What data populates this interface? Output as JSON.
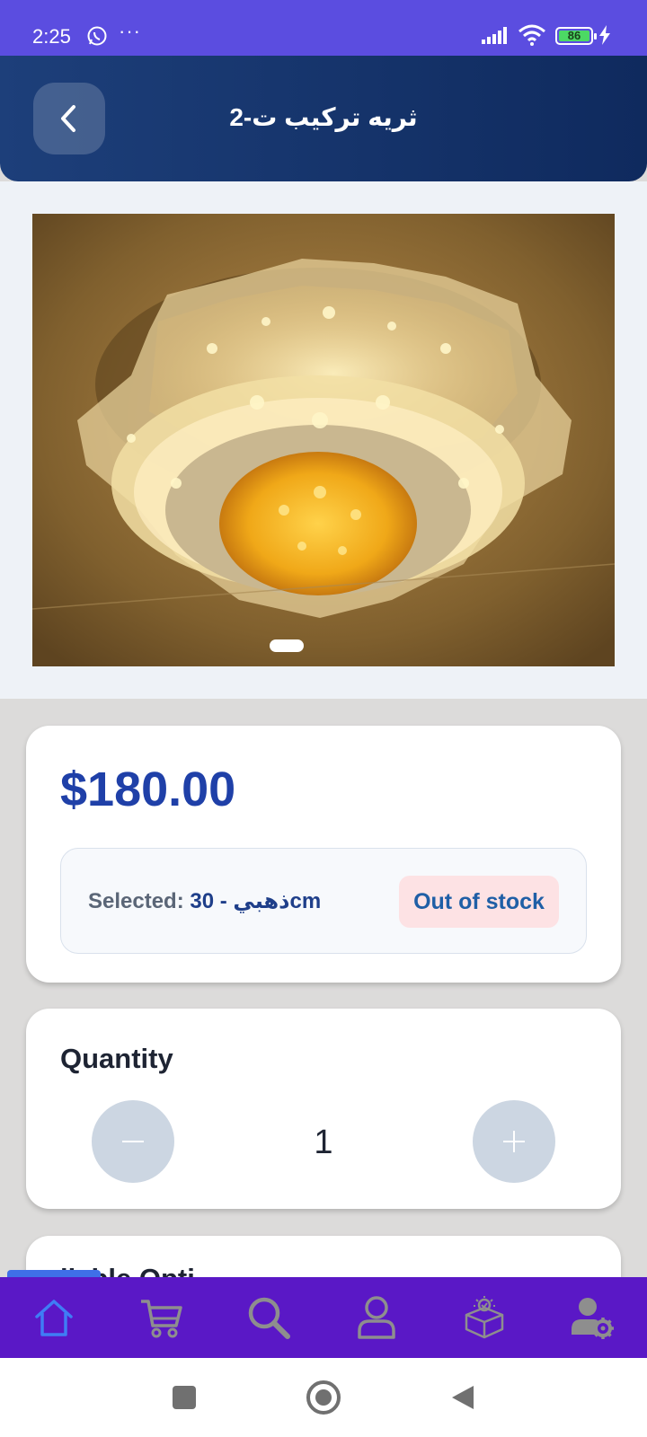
{
  "status_bar": {
    "time": "2:25",
    "dots": "···",
    "battery": "86",
    "icons": [
      "whatsapp-icon",
      "signal-icon",
      "wifi-icon",
      "battery-icon",
      "charging-icon"
    ]
  },
  "header": {
    "title": "ثريه تركيب ت-2",
    "back_icon": "chevron-left-icon",
    "color": "#15346e"
  },
  "product": {
    "image_alt": "chandelier-image",
    "carousel_pages": 1
  },
  "price_card": {
    "price": "$180.00",
    "selected_label": "Selected:",
    "selected_value": "30 - ذهبيcm",
    "stock_status": "Out of stock"
  },
  "quantity": {
    "title": "Quantity",
    "value": "1",
    "minus_icon": "minus-icon",
    "plus_icon": "plus-icon"
  },
  "next_card": {
    "title_partial": "ilable Opti"
  },
  "bottom_nav": {
    "active": "home",
    "items": [
      "home-icon",
      "cart-icon",
      "search-icon",
      "user-icon",
      "box-icon",
      "user-settings-icon"
    ],
    "background": "#5a18c6",
    "active_color": "#3f6fe8"
  },
  "system_nav": {
    "items": [
      "recents-icon",
      "home-circle-icon",
      "back-triangle-icon"
    ]
  }
}
